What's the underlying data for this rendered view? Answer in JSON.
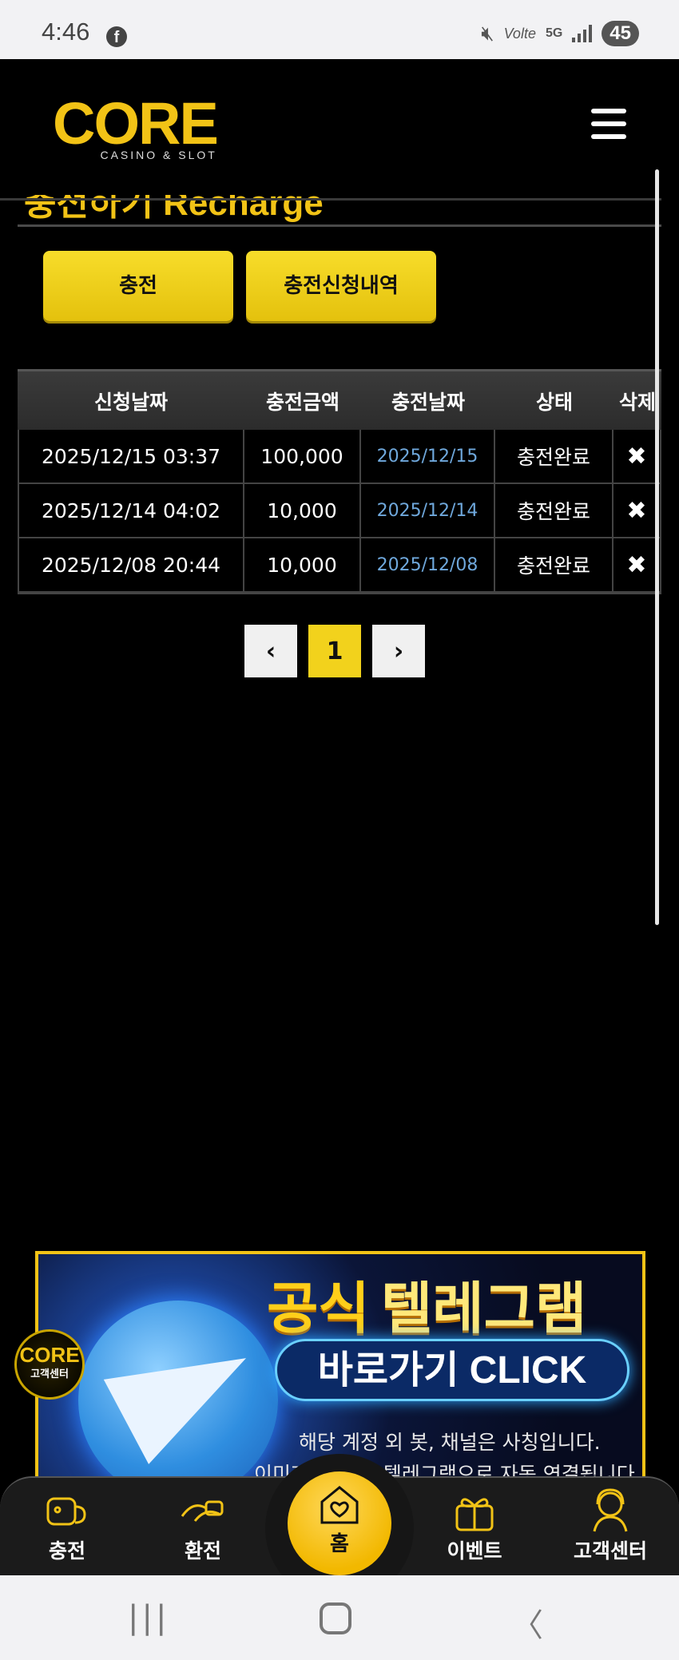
{
  "status_bar": {
    "time": "4:46",
    "battery": "45",
    "network": "5G",
    "volte": "Volte"
  },
  "header": {
    "logo_word": "CORE",
    "logo_sub": "CASINO & SLOT"
  },
  "section": {
    "title_partial": "충전하기 Recharge"
  },
  "buttons": {
    "charge": "충전",
    "history": "충전신청내역"
  },
  "table": {
    "headers": [
      "신청날짜",
      "충전금액",
      "충전날짜",
      "상태",
      "삭제"
    ],
    "rows": [
      {
        "request_date": "2025/12/15 03:37",
        "amount": "100,000",
        "charge_date": "2025/12/15",
        "status": "충전완료",
        "delete": "✖"
      },
      {
        "request_date": "2025/12/14 04:02",
        "amount": "10,000",
        "charge_date": "2025/12/14",
        "status": "충전완료",
        "delete": "✖"
      },
      {
        "request_date": "2025/12/08 20:44",
        "amount": "10,000",
        "charge_date": "2025/12/08",
        "status": "충전완료",
        "delete": "✖"
      }
    ]
  },
  "pagination": {
    "prev": "‹",
    "current": "1",
    "next": "›"
  },
  "banner": {
    "title_a": "공식",
    "title_b": "텔레그램",
    "cta": "바로가기 CLICK",
    "note1": "해당 계정 외 봇, 채널은 사칭입니다.",
    "note2": "이미지 클릭 시 텔레그램으로 자동 연결됩니다."
  },
  "support_badge": {
    "logo": "CORE",
    "label": "고객센터"
  },
  "bottom_nav": {
    "charge": "충전",
    "exchange": "환전",
    "home": "홈",
    "event": "이벤트",
    "support": "고객센터"
  },
  "colors": {
    "accent": "#f2c316",
    "link_date": "#6fa8dc",
    "background": "#000000"
  }
}
